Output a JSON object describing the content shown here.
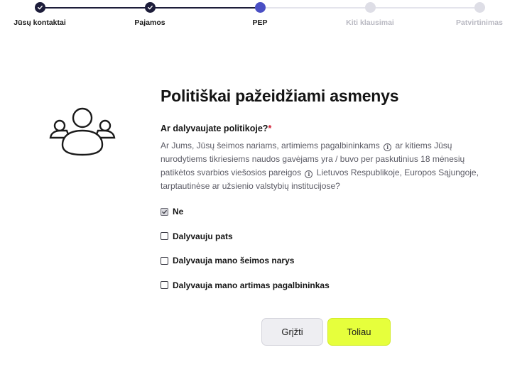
{
  "stepper": {
    "steps": [
      {
        "label": "Jūsų kontaktai",
        "state": "done"
      },
      {
        "label": "Pajamos",
        "state": "done"
      },
      {
        "label": "PEP",
        "state": "active"
      },
      {
        "label": "Kiti klausimai",
        "state": "todo"
      },
      {
        "label": "Patvirtinimas",
        "state": "todo"
      }
    ]
  },
  "illustration": {
    "icon": "people-group-icon"
  },
  "main": {
    "title": "Politiškai pažeidžiami asmenys",
    "question": "Ar dalyvaujate politikoje?",
    "required_mark": "*",
    "description": {
      "part1": "Ar Jums, Jūsų šeimos nariams, artimiems pagalbininkams",
      "part2": "ar kitiems Jūsų nurodytiems tikriesiems naudos gavėjams yra / buvo per paskutinius 18 mėnesių patikėtos svarbios viešosios pareigos",
      "part3": "Lietuvos Respublikoje, Europos Sąjungoje, tarptautinėse ar užsienio valstybių institucijose?"
    },
    "options": [
      {
        "label": "Ne",
        "checked": true
      },
      {
        "label": "Dalyvauju pats",
        "checked": false
      },
      {
        "label": "Dalyvauja mano šeimos narys",
        "checked": false
      },
      {
        "label": "Dalyvauja mano artimas pagalbininkas",
        "checked": false
      }
    ]
  },
  "buttons": {
    "back_label": "Grįžti",
    "next_label": "Toliau"
  },
  "colors": {
    "step_done": "#1d1d3a",
    "step_active": "#4a4fc4",
    "step_todo": "#dedee6",
    "next_button": "#e6ff3c",
    "required": "#d0182e"
  }
}
